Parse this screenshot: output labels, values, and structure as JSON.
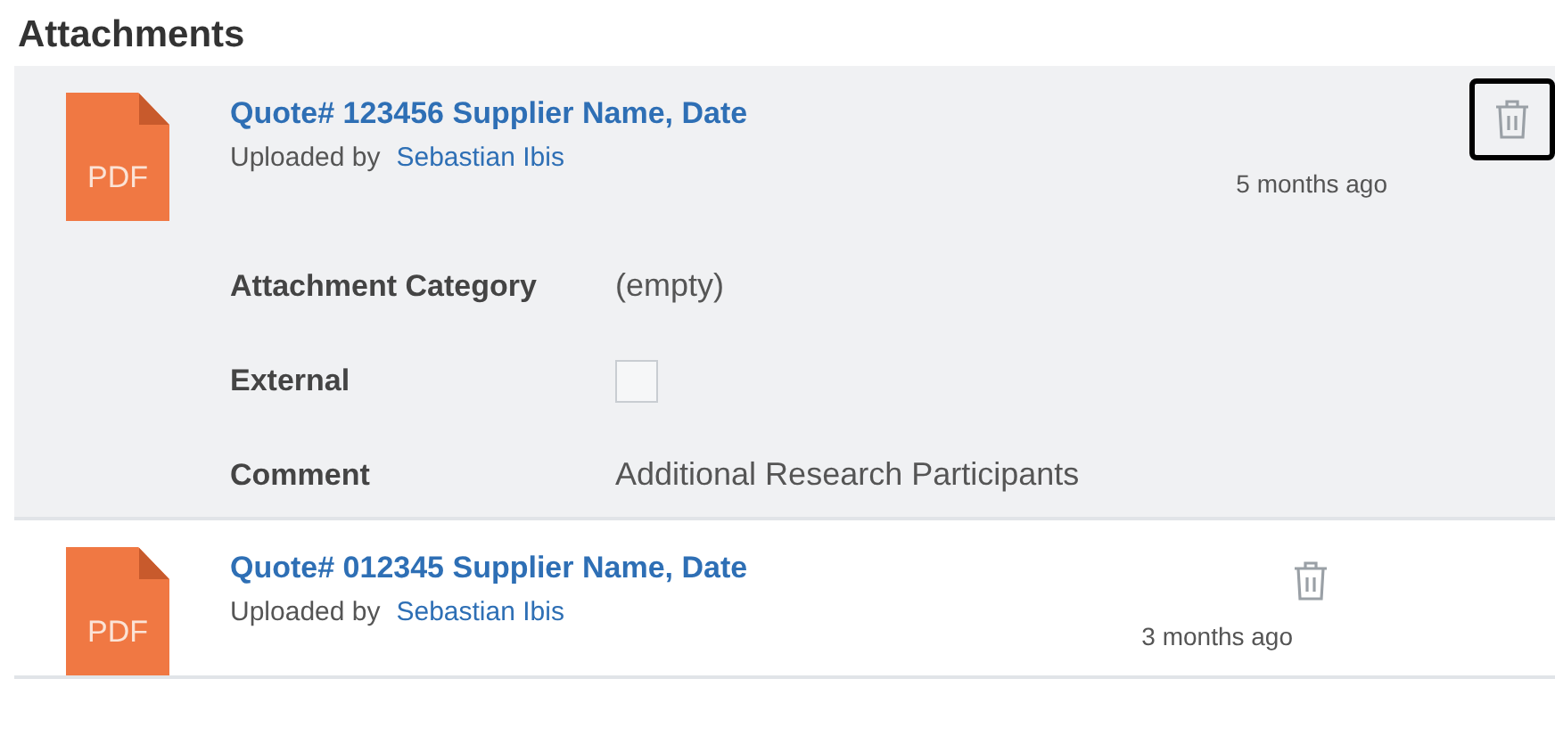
{
  "title": "Attachments",
  "attachments": [
    {
      "file_type": "PDF",
      "name": "Quote# 123456 Supplier Name, Date",
      "uploaded_label": "Uploaded by",
      "uploader": "Sebastian Ibis",
      "time": "5 months ago",
      "expanded": true,
      "highlighted": true,
      "details": [
        {
          "label": "Attachment Category",
          "kind": "text",
          "value": "(empty)"
        },
        {
          "label": "External",
          "kind": "checkbox",
          "checked": false
        },
        {
          "label": "Comment",
          "kind": "text",
          "value": "Additional Research Participants"
        }
      ]
    },
    {
      "file_type": "PDF",
      "name": "Quote# 012345 Supplier Name, Date",
      "uploaded_label": "Uploaded by",
      "uploader": "Sebastian Ibis",
      "time": "3 months ago",
      "expanded": false,
      "highlighted": false
    }
  ]
}
